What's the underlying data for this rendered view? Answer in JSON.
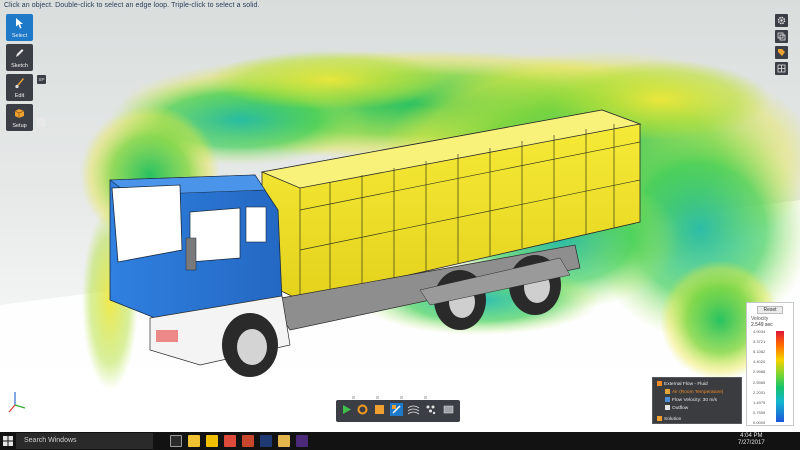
{
  "window": {
    "status_hint": "Click an object. Double-click to select an edge loop. Triple-click to select a solid."
  },
  "left_toolbar": {
    "tools": [
      {
        "label": "Select",
        "icon": "cursor-icon",
        "active": true
      },
      {
        "label": "Sketch",
        "icon": "pencil-icon",
        "active": false
      },
      {
        "label": "Edit",
        "icon": "brush-icon",
        "active": false
      },
      {
        "label": "Setup",
        "icon": "setup-icon",
        "active": false
      }
    ],
    "side_badge": "SP"
  },
  "right_toolbar": {
    "icons": [
      "gear-icon",
      "layers-icon",
      "tag-icon",
      "grid-icon"
    ]
  },
  "legend": {
    "reset_label": "Reset",
    "title": "Velocity",
    "max_value": "2.549 sec",
    "ticks": [
      "4.9034",
      "3.3721",
      "5.1082",
      "4.4020",
      "2.9988",
      "2.5965",
      "2.2031",
      "1.4975",
      "0.7559",
      "0.0000"
    ]
  },
  "tree": {
    "root": "External Flow - Fluid",
    "items": [
      {
        "label": "Air (Room Temperature)",
        "color": "#e0a53a"
      },
      {
        "label": "Flow Velocity: 30 m/s",
        "color": "#4c8fd6"
      },
      {
        "label": "Outflow",
        "color": "#e6e6e6"
      }
    ],
    "footer": "Solution"
  },
  "bottom_toolbar": {
    "icons": [
      "play-icon",
      "refresh-icon",
      "cube-icon",
      "probe-icon",
      "streamline-icon",
      "particles-icon",
      "plane-icon"
    ]
  },
  "taskbar": {
    "search_placeholder": "Search Windows",
    "time": "4:04 PM",
    "date": "7/27/2017",
    "apps": [
      {
        "name": "task-view-icon",
        "color": "#2a2a2a"
      },
      {
        "name": "file-explorer-icon",
        "color": "#f1c232"
      },
      {
        "name": "ansys-icon",
        "color": "#f0c000"
      },
      {
        "name": "chrome-icon",
        "color": "#e04a3a"
      },
      {
        "name": "powerpoint-icon",
        "color": "#c8462b"
      },
      {
        "name": "photoshop-icon",
        "color": "#1f3a72"
      },
      {
        "name": "folder-icon",
        "color": "#e2b64a"
      },
      {
        "name": "after-effects-icon",
        "color": "#4b2a7a"
      }
    ]
  },
  "colors": {
    "accent": "#1f79c9",
    "truck_cab": "#2b78d6",
    "truck_bed": "#f2e22a",
    "chassis": "#8c8c8c"
  }
}
